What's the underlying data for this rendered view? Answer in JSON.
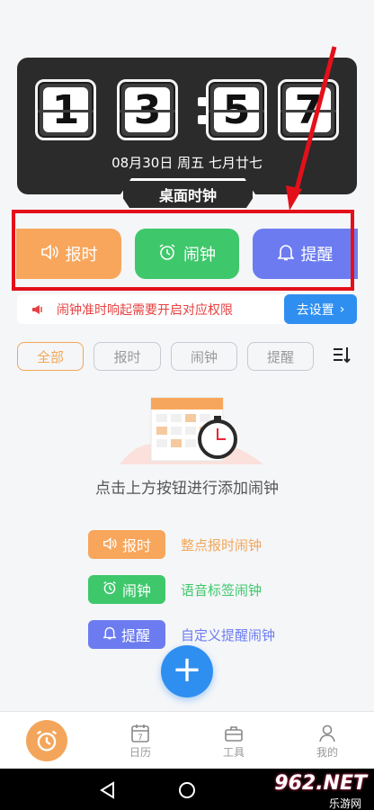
{
  "clock": {
    "digits": [
      "1",
      "3",
      "5",
      "7"
    ],
    "date": "08月30日 周五 七月廿七",
    "tab_label": "桌面时钟"
  },
  "actions": {
    "baoshi": "报时",
    "naozhong": "闹钟",
    "tixing": "提醒"
  },
  "permission": {
    "text": "闹钟准时响起需要开启对应权限",
    "button": "去设置"
  },
  "filters": [
    "全部",
    "报时",
    "闹钟",
    "提醒"
  ],
  "empty": {
    "text": "点击上方按钮进行添加闹钟"
  },
  "legend": [
    {
      "label": "报时",
      "desc": "整点报时闹钟"
    },
    {
      "label": "闹钟",
      "desc": "语音标签闹钟"
    },
    {
      "label": "提醒",
      "desc": "自定义提醒闹钟"
    }
  ],
  "nav": {
    "calendar_day": "7",
    "calendar": "日历",
    "tools": "工具",
    "mine": "我的"
  },
  "watermark": {
    "main": "962.NET",
    "sub": "乐游网"
  },
  "colors": {
    "orange": "#f7a65c",
    "green": "#3ec86b",
    "purple": "#6c7cf0",
    "blue": "#2f8ff0",
    "red": "#e74040"
  }
}
